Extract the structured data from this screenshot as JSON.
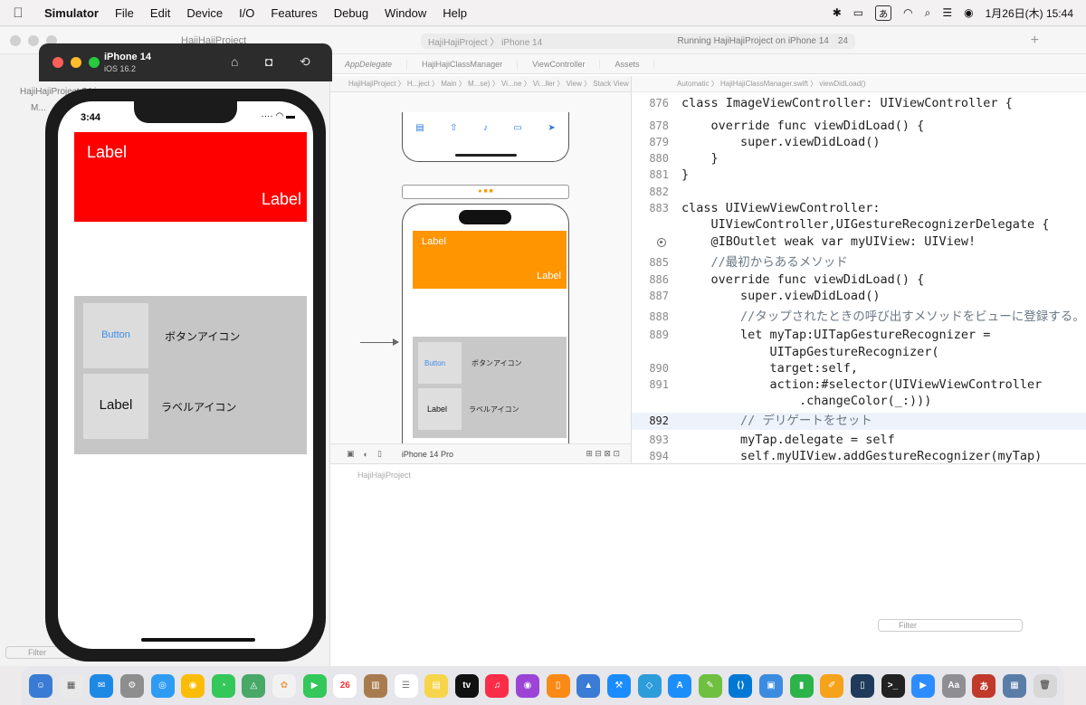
{
  "menubar": {
    "apple": "",
    "app_name": "Simulator",
    "items": [
      "File",
      "Edit",
      "Device",
      "I/O",
      "Features",
      "Debug",
      "Window",
      "Help"
    ],
    "ime": "あ",
    "date_time": "1月26日(木)  15:44"
  },
  "xcode": {
    "project_title": "HajiHajiProject",
    "scheme_target": "HajiHajiProject  〉 iPhone 14",
    "status_text": "Running HajiHajiProject on iPhone 14",
    "warnings": "24",
    "tabs": [
      "AppDelegate",
      "HajiHajiClassManager",
      "ViewController",
      "Assets"
    ],
    "navigator_rows": [
      "HajiHajiProject 24 issues",
      "M..."
    ],
    "storyboard_breadcrumb": "HajiHajiProject 〉 H...ject 〉 Main 〉 M...se) 〉 Vi...ne 〉 Vi...ller 〉 View 〉 Stack View",
    "code_breadcrumb": "Automatic 〉 HajiHajiClassManager.swift 〉 viewDidLoad()",
    "canvas_device": "iPhone 14 Pro",
    "filter_placeholder": "Filter",
    "debug_title": "HajiHajiProject",
    "storyboard": {
      "label_top": "Label",
      "label_bottom": "Label",
      "button": "Button",
      "button_caption": "ボタンアイコン",
      "label_cell": "Label",
      "label_caption": "ラベルアイコン"
    }
  },
  "code": {
    "lines": [
      {
        "num": "876",
        "text": "class ImageViewController: UIViewController {"
      },
      {
        "num": "878",
        "text": "    override func viewDidLoad() {"
      },
      {
        "num": "879",
        "text": "        super.viewDidLoad()"
      },
      {
        "num": "880",
        "text": "    }"
      },
      {
        "num": "881",
        "text": "}"
      },
      {
        "num": "882",
        "text": ""
      },
      {
        "num": "883",
        "text": "class UIViewViewController:"
      },
      {
        "num": "",
        "text": "    UIViewController,UIGestureRecognizerDelegate {"
      },
      {
        "num": "",
        "text": "    @IBOutlet weak var myUIView: UIView!"
      },
      {
        "num": "885",
        "text": "    //最初からあるメソッド"
      },
      {
        "num": "886",
        "text": "    override func viewDidLoad() {"
      },
      {
        "num": "887",
        "text": "        super.viewDidLoad()"
      },
      {
        "num": "888",
        "text": "        //タップされたときの呼び出すメソッドをビューに登録する。"
      },
      {
        "num": "889",
        "text": "        let myTap:UITapGestureRecognizer ="
      },
      {
        "num": "",
        "text": "            UITapGestureRecognizer("
      },
      {
        "num": "890",
        "text": "            target:self,"
      },
      {
        "num": "891",
        "text": "            action:#selector(UIViewViewController"
      },
      {
        "num": "",
        "text": "                .changeColor(_:)))"
      },
      {
        "num": "892",
        "text": "        // デリゲートをセット"
      },
      {
        "num": "893",
        "text": "        myTap.delegate = self"
      },
      {
        "num": "894",
        "text": "        self.myUIView.addGestureRecognizer(myTap)"
      }
    ]
  },
  "simulator": {
    "device": "iPhone 14",
    "os": "iOS 16.2",
    "time": "3:44",
    "red_label_1": "Label",
    "red_label_2": "Label",
    "button_text": "Button",
    "button_caption": "ボタンアイコン",
    "label_text": "Label",
    "label_caption": "ラベルアイコン"
  },
  "dock": {
    "calendar_day": "26",
    "ime": "あ"
  }
}
